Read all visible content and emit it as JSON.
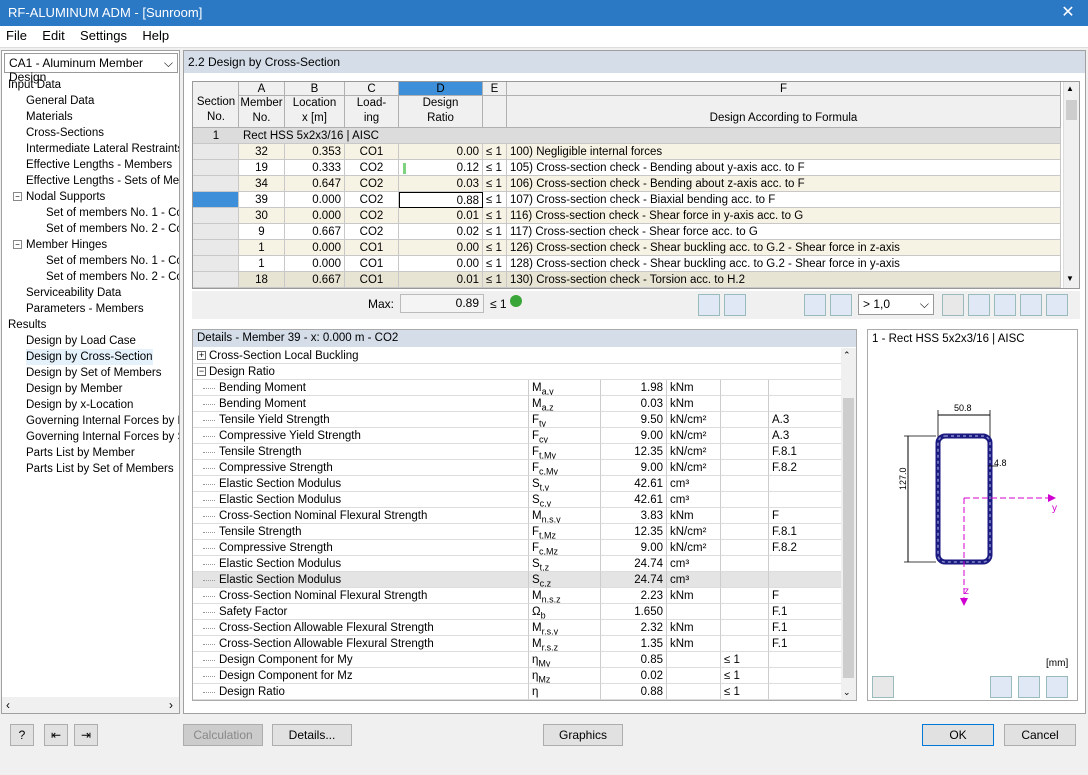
{
  "window": {
    "title": "RF-ALUMINUM ADM - [Sunroom]"
  },
  "menu": [
    "File",
    "Edit",
    "Settings",
    "Help"
  ],
  "left": {
    "case_select": "CA1 - Aluminum Member Design",
    "tree": [
      {
        "label": "Input Data",
        "level": 0
      },
      {
        "label": "General Data",
        "level": 1
      },
      {
        "label": "Materials",
        "level": 1
      },
      {
        "label": "Cross-Sections",
        "level": 1
      },
      {
        "label": "Intermediate Lateral Restraints",
        "level": 1
      },
      {
        "label": "Effective Lengths - Members",
        "level": 1
      },
      {
        "label": "Effective Lengths - Sets of Mem",
        "level": 1
      },
      {
        "label": "Nodal Supports",
        "level": 1,
        "expander": "−"
      },
      {
        "label": "Set of members No. 1 - Cor",
        "level": 2
      },
      {
        "label": "Set of members No. 2 - Cor",
        "level": 2
      },
      {
        "label": "Member Hinges",
        "level": 1,
        "expander": "−"
      },
      {
        "label": "Set of members No. 1 - Cor",
        "level": 2
      },
      {
        "label": "Set of members No. 2 - Cor",
        "level": 2
      },
      {
        "label": "Serviceability Data",
        "level": 1
      },
      {
        "label": "Parameters - Members",
        "level": 1
      },
      {
        "label": "Results",
        "level": 0
      },
      {
        "label": "Design by Load Case",
        "level": 1
      },
      {
        "label": "Design by Cross-Section",
        "level": 1,
        "selected": true
      },
      {
        "label": "Design by Set of Members",
        "level": 1
      },
      {
        "label": "Design by Member",
        "level": 1
      },
      {
        "label": "Design by x-Location",
        "level": 1
      },
      {
        "label": "Governing Internal Forces by M",
        "level": 1
      },
      {
        "label": "Governing Internal Forces by Se",
        "level": 1
      },
      {
        "label": "Parts List by Member",
        "level": 1
      },
      {
        "label": "Parts List by Set of Members",
        "level": 1
      }
    ]
  },
  "panel": {
    "title": "2.2 Design by Cross-Section"
  },
  "table": {
    "col_letters": [
      "A",
      "B",
      "C",
      "D",
      "E",
      "F"
    ],
    "headers": {
      "section": [
        "Section",
        "No."
      ],
      "a": [
        "Member",
        "No."
      ],
      "b": [
        "Location",
        "x [m]"
      ],
      "c": [
        "Load-",
        "ing"
      ],
      "d": [
        "Design",
        "Ratio"
      ],
      "f": "Design According to Formula"
    },
    "group": {
      "no": "1",
      "label": "Rect HSS 5x2x3/16 | AISC"
    },
    "rows": [
      {
        "member": "32",
        "x": "0.353",
        "load": "CO1",
        "ratio": "0.00",
        "le": "≤ 1",
        "formula": "100) Negligible internal forces"
      },
      {
        "member": "19",
        "x": "0.333",
        "load": "CO2",
        "ratio": "0.12",
        "le": "≤ 1",
        "formula": "105) Cross-section check - Bending about y-axis acc. to F"
      },
      {
        "member": "34",
        "x": "0.647",
        "load": "CO2",
        "ratio": "0.03",
        "le": "≤ 1",
        "formula": "106) Cross-section check - Bending about z-axis acc. to F"
      },
      {
        "member": "39",
        "x": "0.000",
        "load": "CO2",
        "ratio": "0.88",
        "le": "≤ 1",
        "formula": "107) Cross-section check - Biaxial bending acc. to F"
      },
      {
        "member": "30",
        "x": "0.000",
        "load": "CO2",
        "ratio": "0.01",
        "le": "≤ 1",
        "formula": "116) Cross-section check - Shear force in y-axis acc. to G"
      },
      {
        "member": "9",
        "x": "0.667",
        "load": "CO2",
        "ratio": "0.02",
        "le": "≤ 1",
        "formula": "117) Cross-section check - Shear force acc. to G"
      },
      {
        "member": "1",
        "x": "0.000",
        "load": "CO1",
        "ratio": "0.00",
        "le": "≤ 1",
        "formula": "126) Cross-section check - Shear buckling acc. to G.2 - Shear force in z-axis"
      },
      {
        "member": "1",
        "x": "0.000",
        "load": "CO1",
        "ratio": "0.00",
        "le": "≤ 1",
        "formula": "128) Cross-section check - Shear buckling acc. to G.2 - Shear force in y-axis"
      },
      {
        "member": "18",
        "x": "0.667",
        "load": "CO1",
        "ratio": "0.01",
        "le": "≤ 1",
        "formula": "130) Cross-section check - Torsion acc. to H.2"
      }
    ],
    "max_label": "Max:",
    "max_value": "0.89",
    "max_le": "≤ 1",
    "filter_value": "> 1,0"
  },
  "details": {
    "title": "Details - Member 39 - x: 0.000 m - CO2",
    "groups": [
      {
        "label": "Cross-Section Local Buckling",
        "sign": "+"
      },
      {
        "label": "Design Ratio",
        "sign": "−"
      }
    ],
    "rows": [
      {
        "name": "Bending Moment",
        "sym": "M",
        "sub": "a,y",
        "val": "1.98",
        "unit": "kNm",
        "le": "",
        "ref": ""
      },
      {
        "name": "Bending Moment",
        "sym": "M",
        "sub": "a,z",
        "val": "0.03",
        "unit": "kNm",
        "le": "",
        "ref": ""
      },
      {
        "name": "Tensile Yield Strength",
        "sym": "F",
        "sub": "ty",
        "val": "9.50",
        "unit": "kN/cm²",
        "le": "",
        "ref": "A.3"
      },
      {
        "name": "Compressive Yield Strength",
        "sym": "F",
        "sub": "cy",
        "val": "9.00",
        "unit": "kN/cm²",
        "le": "",
        "ref": "A.3"
      },
      {
        "name": "Tensile Strength",
        "sym": "F",
        "sub": "t,My",
        "val": "12.35",
        "unit": "kN/cm²",
        "le": "",
        "ref": "F.8.1"
      },
      {
        "name": "Compressive Strength",
        "sym": "F",
        "sub": "c,My",
        "val": "9.00",
        "unit": "kN/cm²",
        "le": "",
        "ref": "F.8.2"
      },
      {
        "name": "Elastic Section Modulus",
        "sym": "S",
        "sub": "t,y",
        "val": "42.61",
        "unit": "cm³",
        "le": "",
        "ref": ""
      },
      {
        "name": "Elastic Section Modulus",
        "sym": "S",
        "sub": "c,y",
        "val": "42.61",
        "unit": "cm³",
        "le": "",
        "ref": ""
      },
      {
        "name": "Cross-Section Nominal Flexural Strength",
        "sym": "M",
        "sub": "n.s.y",
        "val": "3.83",
        "unit": "kNm",
        "le": "",
        "ref": "F"
      },
      {
        "name": "Tensile Strength",
        "sym": "F",
        "sub": "t,Mz",
        "val": "12.35",
        "unit": "kN/cm²",
        "le": "",
        "ref": "F.8.1"
      },
      {
        "name": "Compressive Strength",
        "sym": "F",
        "sub": "c,Mz",
        "val": "9.00",
        "unit": "kN/cm²",
        "le": "",
        "ref": "F.8.2"
      },
      {
        "name": "Elastic Section Modulus",
        "sym": "S",
        "sub": "t,z",
        "val": "24.74",
        "unit": "cm³",
        "le": "",
        "ref": ""
      },
      {
        "name": "Elastic Section Modulus",
        "sym": "S",
        "sub": "c,z",
        "val": "24.74",
        "unit": "cm³",
        "le": "",
        "ref": "",
        "selected": true
      },
      {
        "name": "Cross-Section Nominal Flexural Strength",
        "sym": "M",
        "sub": "n.s.z",
        "val": "2.23",
        "unit": "kNm",
        "le": "",
        "ref": "F"
      },
      {
        "name": "Safety Factor",
        "sym": "Ω",
        "sub": "b",
        "val": "1.650",
        "unit": "",
        "le": "",
        "ref": "F.1"
      },
      {
        "name": "Cross-Section Allowable Flexural Strength",
        "sym": "M",
        "sub": "r.s.y",
        "val": "2.32",
        "unit": "kNm",
        "le": "",
        "ref": "F.1"
      },
      {
        "name": "Cross-Section Allowable Flexural Strength",
        "sym": "M",
        "sub": "r.s.z",
        "val": "1.35",
        "unit": "kNm",
        "le": "",
        "ref": "F.1"
      },
      {
        "name": "Design Component for My",
        "sym": "η",
        "sub": "My",
        "val": "0.85",
        "unit": "",
        "le": "≤ 1",
        "ref": ""
      },
      {
        "name": "Design Component for Mz",
        "sym": "η",
        "sub": "Mz",
        "val": "0.02",
        "unit": "",
        "le": "≤ 1",
        "ref": ""
      },
      {
        "name": "Design Ratio",
        "sym": "η",
        "sub": "",
        "val": "0.88",
        "unit": "",
        "le": "≤ 1",
        "ref": ""
      }
    ]
  },
  "graphic": {
    "title": "1 - Rect HSS 5x2x3/16 | AISC",
    "dim_width": "50.8",
    "dim_height": "127.0",
    "dim_thick": "4.8",
    "axis_y": "y",
    "axis_z": "z",
    "unit": "[mm]"
  },
  "footer": {
    "calc": "Calculation",
    "details": "Details...",
    "graphics": "Graphics",
    "ok": "OK",
    "cancel": "Cancel"
  }
}
